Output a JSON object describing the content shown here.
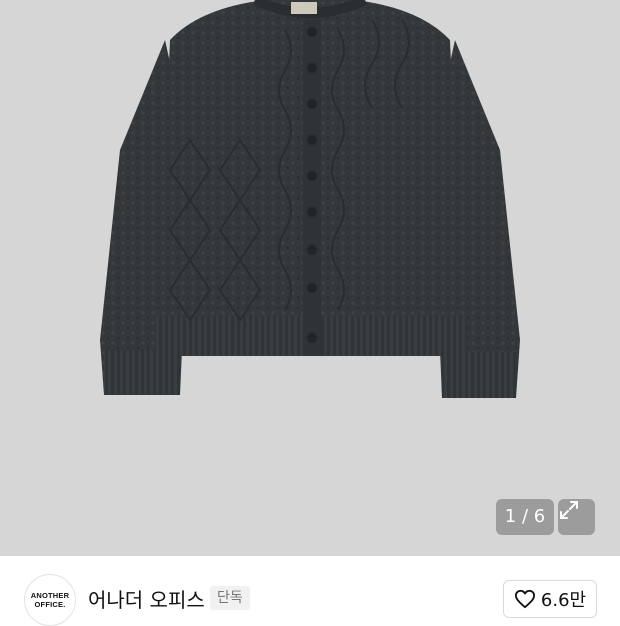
{
  "product_image": {
    "alt": "",
    "description_icon": "knit-cardigan-photo"
  },
  "gallery": {
    "counter": "1 / 6",
    "expand_icon": "expand-icon"
  },
  "brand": {
    "logo_line1": "ANOTHER",
    "logo_line2": "OFFICE.",
    "name": "어나더 오피스",
    "tag": "단독"
  },
  "like": {
    "icon": "heart-icon",
    "count": "6.6만"
  },
  "colors": {
    "background": "#d6d6d6",
    "sweater": "#33373a",
    "overlay": "#6e6e6e"
  }
}
